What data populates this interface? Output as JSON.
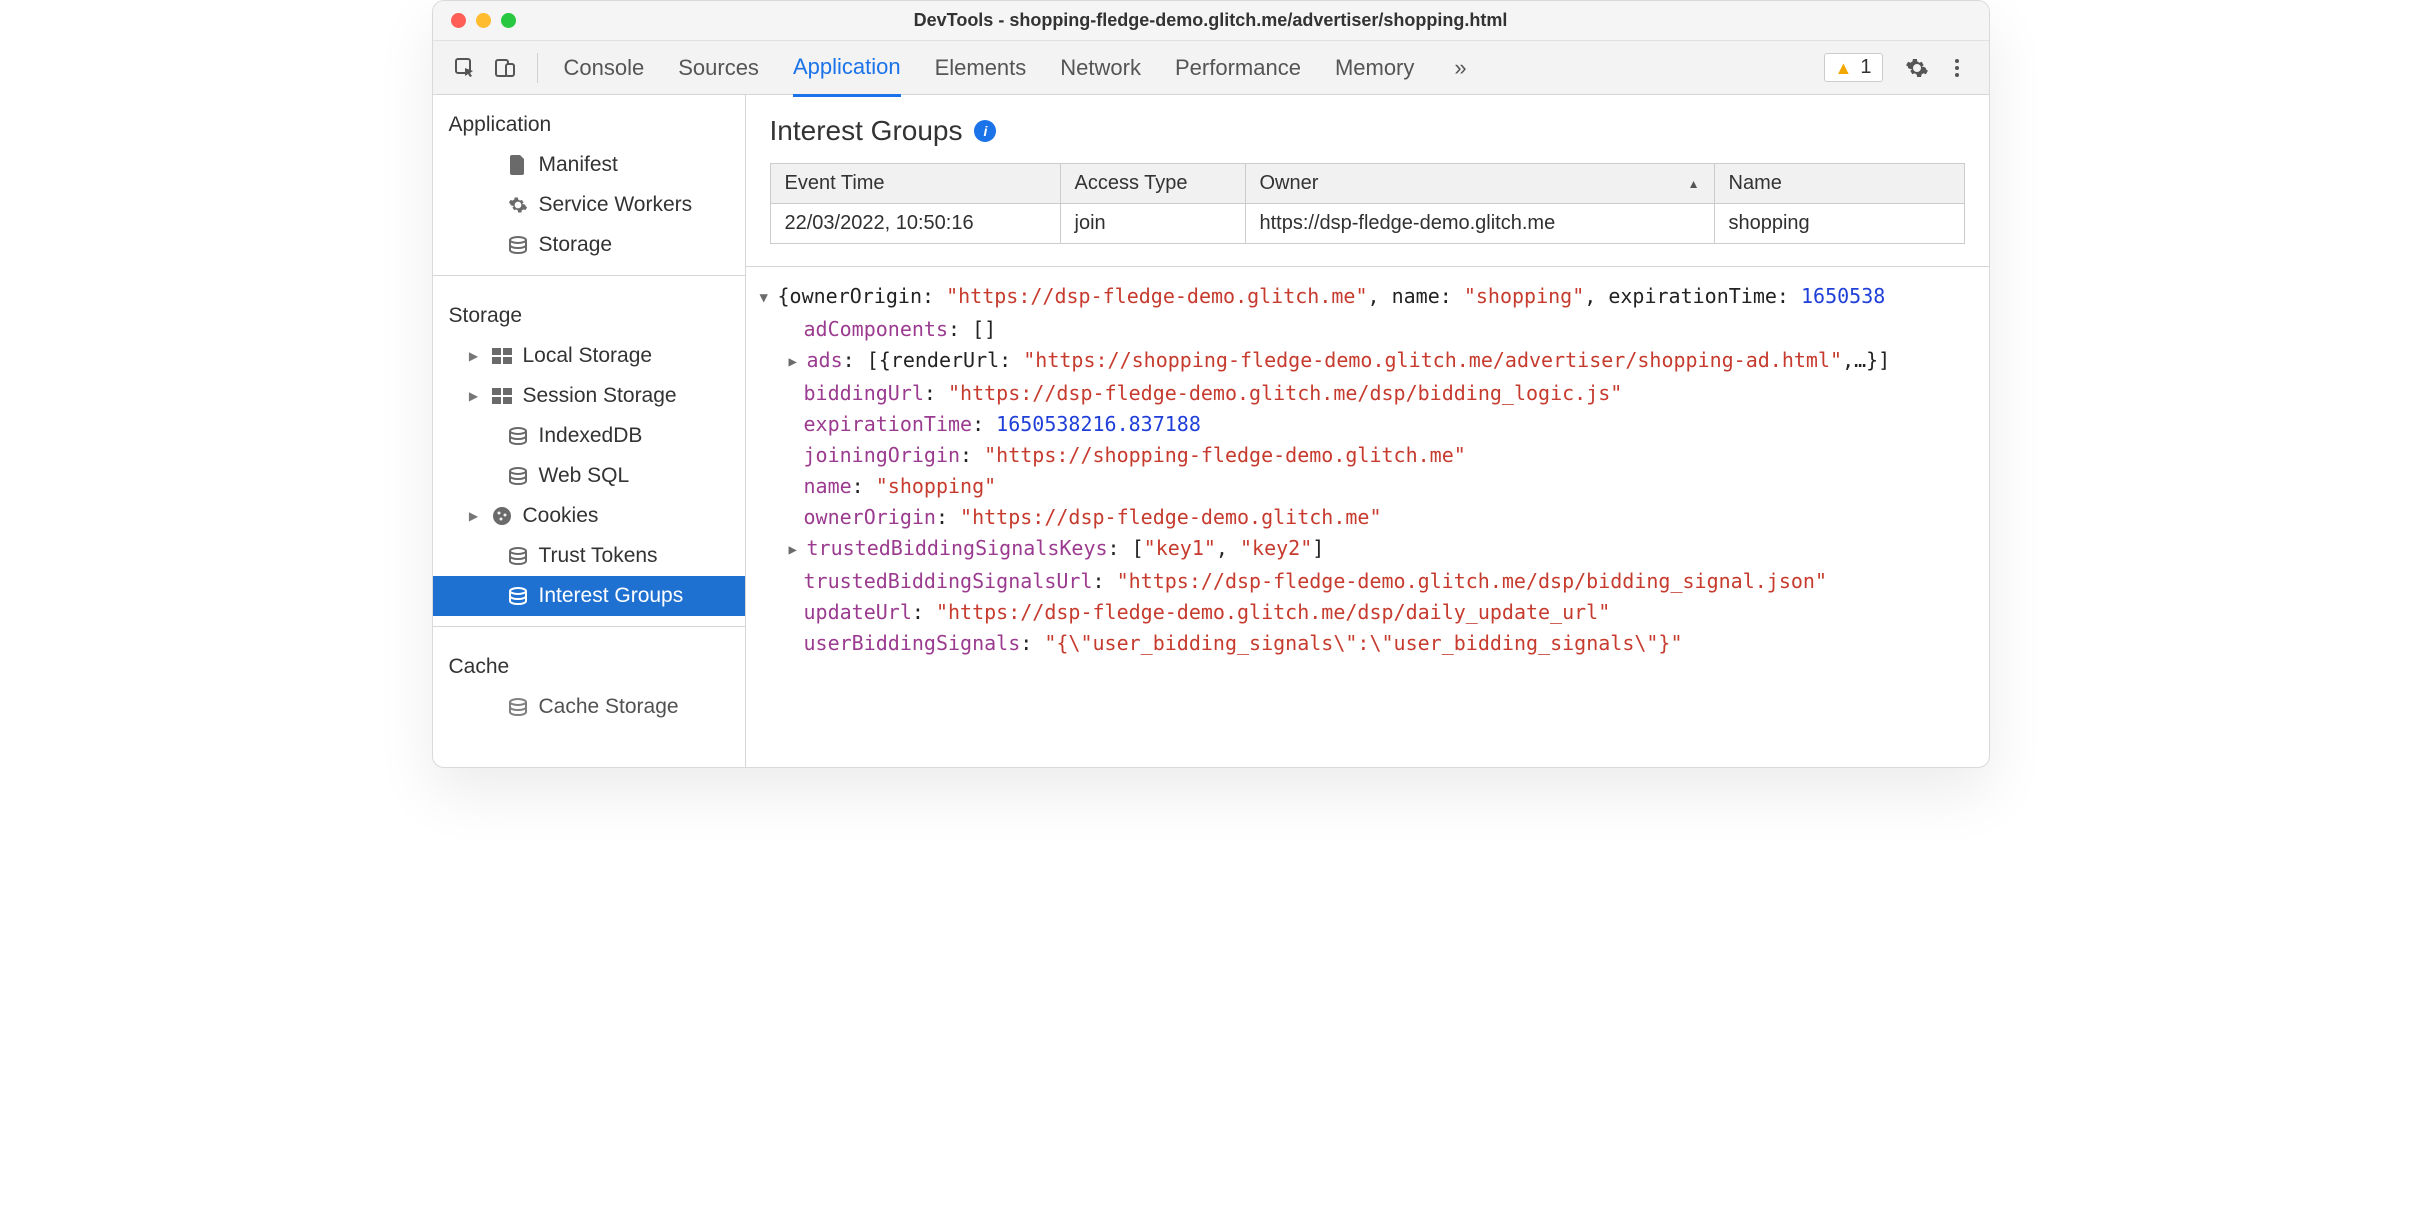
{
  "window": {
    "title": "DevTools - shopping-fledge-demo.glitch.me/advertiser/shopping.html"
  },
  "toolbar": {
    "tabs": [
      "Console",
      "Sources",
      "Application",
      "Elements",
      "Network",
      "Performance",
      "Memory"
    ],
    "active_tab": "Application",
    "warning_count": "1"
  },
  "sidebar": {
    "sections": [
      {
        "title": "Application",
        "items": [
          {
            "label": "Manifest",
            "icon": "file-icon"
          },
          {
            "label": "Service Workers",
            "icon": "gear-icon"
          },
          {
            "label": "Storage",
            "icon": "db-icon"
          }
        ]
      },
      {
        "title": "Storage",
        "items": [
          {
            "label": "Local Storage",
            "icon": "grid-icon",
            "expandable": true
          },
          {
            "label": "Session Storage",
            "icon": "grid-icon",
            "expandable": true
          },
          {
            "label": "IndexedDB",
            "icon": "db-icon"
          },
          {
            "label": "Web SQL",
            "icon": "db-icon"
          },
          {
            "label": "Cookies",
            "icon": "cookie-icon",
            "expandable": true
          },
          {
            "label": "Trust Tokens",
            "icon": "db-icon"
          },
          {
            "label": "Interest Groups",
            "icon": "db-icon",
            "selected": true
          }
        ]
      },
      {
        "title": "Cache",
        "items": [
          {
            "label": "Cache Storage",
            "icon": "db-icon"
          }
        ]
      }
    ]
  },
  "panel": {
    "title": "Interest Groups"
  },
  "table": {
    "headers": [
      "Event Time",
      "Access Type",
      "Owner",
      "Name"
    ],
    "sort_col": 2,
    "rows": [
      [
        "22/03/2022, 10:50:16",
        "join",
        "https://dsp-fledge-demo.glitch.me",
        "shopping"
      ]
    ]
  },
  "detail": {
    "summary_prefix": "{ownerOrigin: ",
    "summary_owner": "\"https://dsp-fledge-demo.glitch.me\"",
    "summary_mid1": ", name: ",
    "summary_name": "\"shopping\"",
    "summary_mid2": ", expirationTime: ",
    "summary_exp": "1650538",
    "adComponents_key": "adComponents",
    "adComponents_val": "[]",
    "ads_key": "ads",
    "ads_val_prefix": "[{renderUrl: ",
    "ads_val_url": "\"https://shopping-fledge-demo.glitch.me/advertiser/shopping-ad.html\"",
    "ads_val_suffix": ",…}]",
    "biddingUrl_key": "biddingUrl",
    "biddingUrl_val": "\"https://dsp-fledge-demo.glitch.me/dsp/bidding_logic.js\"",
    "expirationTime_key": "expirationTime",
    "expirationTime_val": "1650538216.837188",
    "joiningOrigin_key": "joiningOrigin",
    "joiningOrigin_val": "\"https://shopping-fledge-demo.glitch.me\"",
    "name_key": "name",
    "name_val": "\"shopping\"",
    "ownerOrigin_key": "ownerOrigin",
    "ownerOrigin_val": "\"https://dsp-fledge-demo.glitch.me\"",
    "tbsk_key": "trustedBiddingSignalsKeys",
    "tbsk_val_open": "[",
    "tbsk_val_k1": "\"key1\"",
    "tbsk_val_sep": ", ",
    "tbsk_val_k2": "\"key2\"",
    "tbsk_val_close": "]",
    "tbsu_key": "trustedBiddingSignalsUrl",
    "tbsu_val": "\"https://dsp-fledge-demo.glitch.me/dsp/bidding_signal.json\"",
    "updateUrl_key": "updateUrl",
    "updateUrl_val": "\"https://dsp-fledge-demo.glitch.me/dsp/daily_update_url\"",
    "ubs_key": "userBiddingSignals",
    "ubs_val": "\"{\\\"user_bidding_signals\\\":\\\"user_bidding_signals\\\"}\""
  }
}
